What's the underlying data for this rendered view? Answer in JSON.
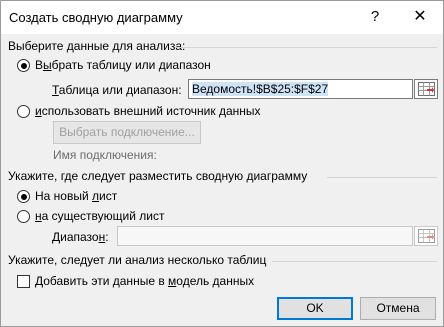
{
  "window": {
    "title": "Создать сводную диаграмму",
    "help_label": "?",
    "close_label": "✕"
  },
  "section_data": {
    "heading": "Выберите данные для анализа:",
    "option_table_prefix": "В",
    "option_table_underline": "ы",
    "option_table_rest": "брать таблицу или диапазон",
    "option_table_checked": true,
    "range_label_prefix": "",
    "range_label_underline": "Т",
    "range_label_rest": "аблица или диапазон:",
    "range_value": "Ведомость!$B$25:$F$27",
    "option_external_prefix": "",
    "option_external_underline": "и",
    "option_external_rest": "спользовать внешний источник данных",
    "option_external_checked": false,
    "connect_button": "Выбрать подключение...",
    "connection_name_label": "Имя подключения:"
  },
  "section_place": {
    "heading": "Укажите, где следует разместить сводную диаграмму",
    "option_new_prefix": "На новый ",
    "option_new_underline": "л",
    "option_new_rest": "ист",
    "option_new_checked": true,
    "option_existing_prefix": "",
    "option_existing_underline": "н",
    "option_existing_rest": "а существующий лист",
    "option_existing_checked": false,
    "range_label_prefix": "Диапазо",
    "range_label_underline": "н",
    "range_label_rest": ":",
    "range_value": ""
  },
  "section_multi": {
    "heading": "Укажите, следует ли анализ несколько таблиц",
    "checkbox_prefix": "Добавить эти данные в ",
    "checkbox_underline": "м",
    "checkbox_rest": "одель данных",
    "checked": false
  },
  "buttons": {
    "ok": "OK",
    "cancel": "Отмена"
  }
}
